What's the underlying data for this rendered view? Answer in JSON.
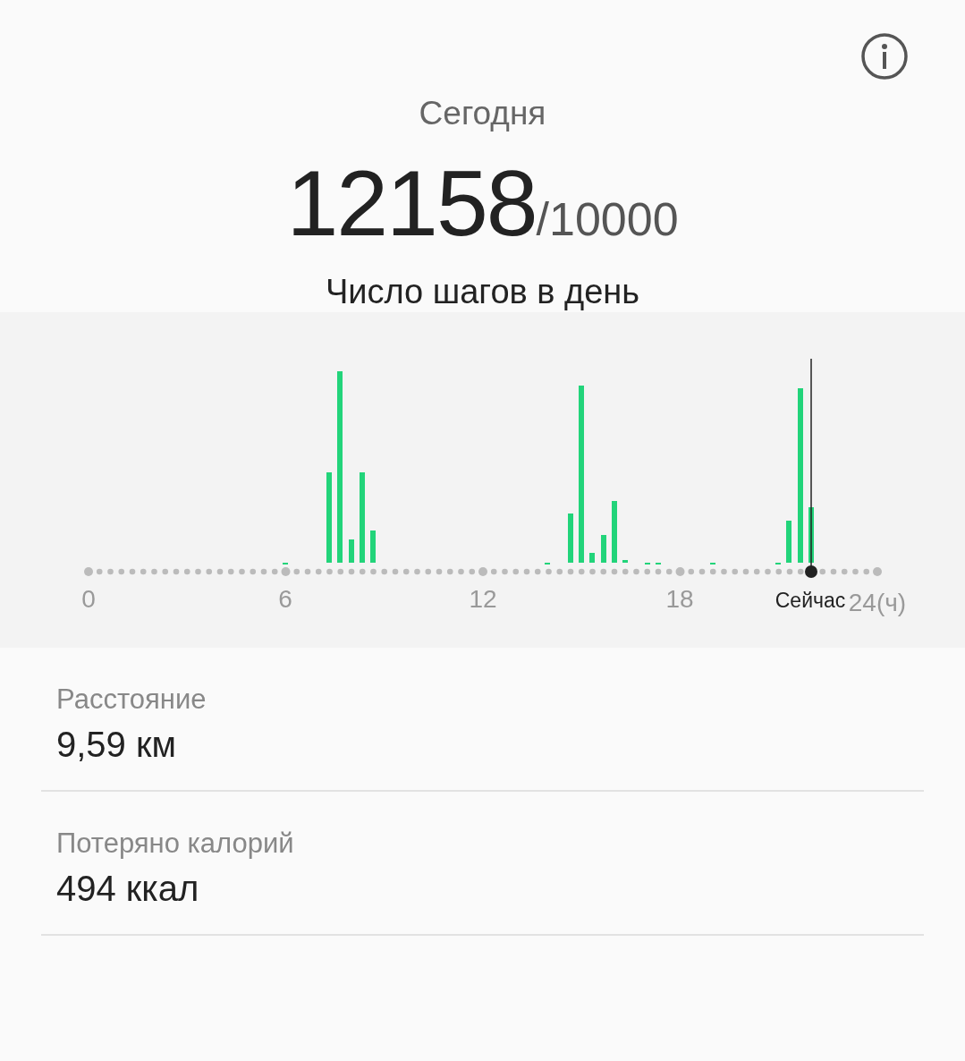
{
  "header": {
    "title": "Сегодня",
    "steps": "12158",
    "goal": "/10000",
    "caption": "Число шагов в день"
  },
  "chart": {
    "x_labels": [
      "0",
      "6",
      "12",
      "18"
    ],
    "now_label": "Сейчас",
    "end_label": "24(ч)"
  },
  "stats": [
    {
      "label": "Расстояние",
      "value": "9,59 км"
    },
    {
      "label": "Потеряно калорий",
      "value": "494 ккал"
    }
  ]
}
